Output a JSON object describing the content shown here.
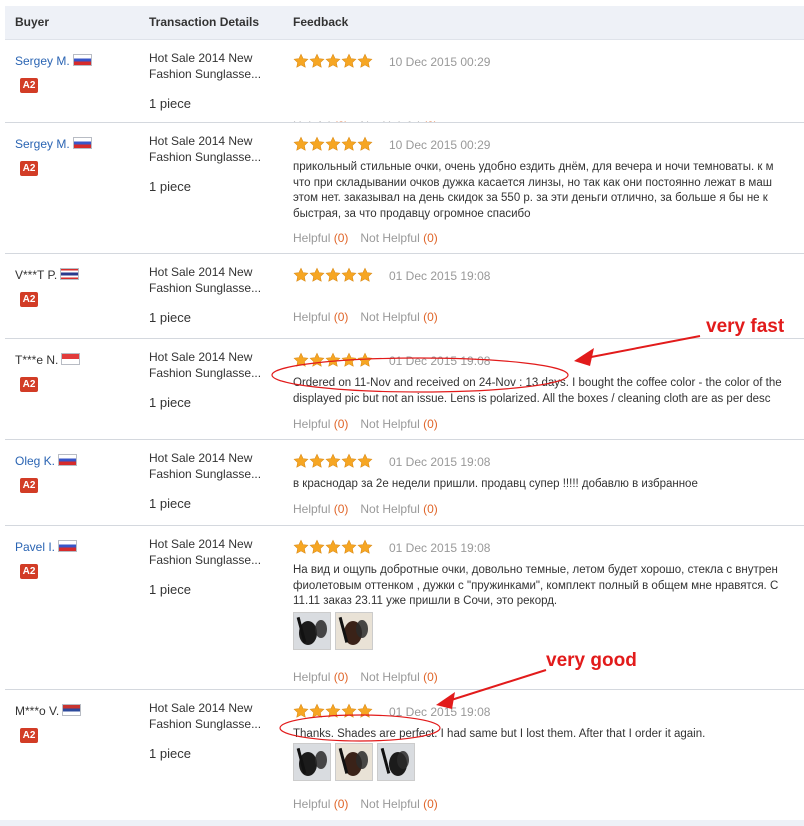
{
  "header": {
    "buyer": "Buyer",
    "transaction": "Transaction Details",
    "feedback": "Feedback"
  },
  "reviews": [
    {
      "buyer": "Sergey M.",
      "buyer_is_link": true,
      "flag": "ru",
      "badge": "A2",
      "product_line1": "Hot Sale 2014 New",
      "product_line2": "Fashion Sunglasse...",
      "quantity": "1 piece",
      "stars": 5,
      "date": "10 Dec 2015 00:29",
      "text": [],
      "thumbs": 0,
      "helpful_label": "Helpful",
      "helpful_count": "(0)",
      "not_helpful_label": "Not Helpful",
      "not_helpful_count": "(0)"
    },
    {
      "buyer": "Sergey M.",
      "buyer_is_link": true,
      "flag": "ru",
      "badge": "A2",
      "product_line1": "Hot Sale 2014 New",
      "product_line2": "Fashion Sunglasse...",
      "quantity": "1 piece",
      "stars": 5,
      "date": "10 Dec 2015 00:29",
      "text": [
        "прикольный стильные очки, очень удобно ездить днём, для вечера и ночи темноваты. к м",
        "что при складывании очков дужка касается линзы, но так как они постоянно лежат в маш",
        "этом нет. заказывал на день скидок за 550 р. за эти деньги отлично, за больше я бы не к",
        "быстрая, за что продавцу огромное спасибо"
      ],
      "thumbs": 0,
      "helpful_label": "Helpful",
      "helpful_count": "(0)",
      "not_helpful_label": "Not Helpful",
      "not_helpful_count": "(0)"
    },
    {
      "buyer": "V***T P.",
      "buyer_is_link": false,
      "flag": "th",
      "badge": "A2",
      "product_line1": "Hot Sale 2014 New",
      "product_line2": "Fashion Sunglasse...",
      "quantity": "1 piece",
      "stars": 5,
      "date": "01 Dec 2015 19:08",
      "text": [],
      "thumbs": 0,
      "helpful_label": "Helpful",
      "helpful_count": "(0)",
      "not_helpful_label": "Not Helpful",
      "not_helpful_count": "(0)"
    },
    {
      "buyer": "T***e N.",
      "buyer_is_link": false,
      "flag": "sg",
      "badge": "A2",
      "product_line1": "Hot Sale 2014 New",
      "product_line2": "Fashion Sunglasse...",
      "quantity": "1 piece",
      "stars": 5,
      "date": "01 Dec 2015 19:08",
      "text": [
        "Ordered on 11-Nov and received on 24-Nov : 13 days. I bought the coffee color - the color of the",
        "displayed pic but not an issue. Lens is polarized. All the boxes / cleaning cloth are as per desc"
      ],
      "thumbs": 0,
      "helpful_label": "Helpful",
      "helpful_count": "(0)",
      "not_helpful_label": "Not Helpful",
      "not_helpful_count": "(0)"
    },
    {
      "buyer": "Oleg K.",
      "buyer_is_link": true,
      "flag": "ru",
      "badge": "A2",
      "product_line1": "Hot Sale 2014 New",
      "product_line2": "Fashion Sunglasse...",
      "quantity": "1 piece",
      "stars": 5,
      "date": "01 Dec 2015 19:08",
      "text": [
        "в краснодар за 2е недели пришли. продавц супер !!!!! добавлю в избранное"
      ],
      "thumbs": 0,
      "helpful_label": "Helpful",
      "helpful_count": "(0)",
      "not_helpful_label": "Not Helpful",
      "not_helpful_count": "(0)"
    },
    {
      "buyer": "Pavel I.",
      "buyer_is_link": true,
      "flag": "ru",
      "badge": "A2",
      "product_line1": "Hot Sale 2014 New",
      "product_line2": "Fashion Sunglasse...",
      "quantity": "1 piece",
      "stars": 5,
      "date": "01 Dec 2015 19:08",
      "text": [
        "На вид и ощупь добротные очки, довольно темные, летом будет хорошо, стекла с внутрен",
        "фиолетовым оттенком , дужки с \"пружинками\", комплект полный в общем мне нравятся. С",
        "11.11 заказ 23.11 уже пришли в Сочи, это рекорд."
      ],
      "thumbs": 2,
      "helpful_label": "Helpful",
      "helpful_count": "(0)",
      "not_helpful_label": "Not Helpful",
      "not_helpful_count": "(0)"
    },
    {
      "buyer": "M***o V.",
      "buyer_is_link": false,
      "flag": "rs",
      "badge": "A2",
      "product_line1": "Hot Sale 2014 New",
      "product_line2": "Fashion Sunglasse...",
      "quantity": "1 piece",
      "stars": 5,
      "date": "01 Dec 2015 19:08",
      "text": [
        "Thanks. Shades are perfect. I had same but I lost them. After that I order it again."
      ],
      "thumbs": 3,
      "helpful_label": "Helpful",
      "helpful_count": "(0)",
      "not_helpful_label": "Not Helpful",
      "not_helpful_count": "(0)"
    }
  ],
  "annotations": {
    "first": "very fast",
    "second": "very good",
    "color": "#e21b1b"
  },
  "colors": {
    "link": "#2a64b3",
    "star": "#f6a623",
    "count": "#e0662a",
    "badge": "#d23c26",
    "header_bg": "#eef1f7"
  }
}
